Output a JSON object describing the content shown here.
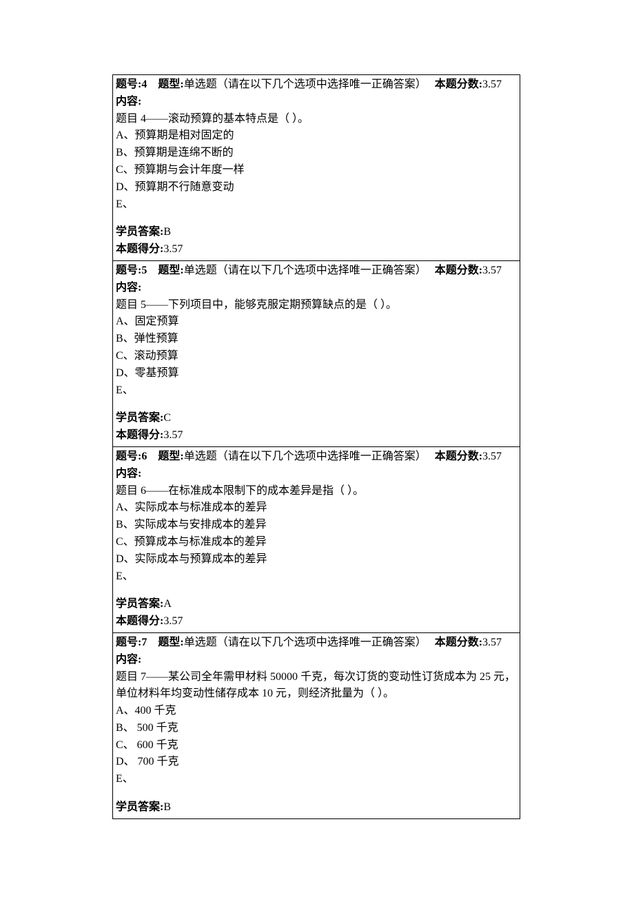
{
  "labels": {
    "qnum_prefix": "题号:",
    "qtype_prefix": "题型:",
    "score_prefix": "本题分数:",
    "content_label": "内容:",
    "student_answer_prefix": "学员答案:",
    "earned_prefix": "本题得分:"
  },
  "questions": [
    {
      "num": "4",
      "type": "单选题（请在以下几个选项中选择唯一正确答案）",
      "score": "3.57",
      "stem": "题目 4——滚动预算的基本特点是（ ）。",
      "opts": {
        "A": "A、预算期是相对固定的",
        "B": "B、预算期是连绵不断的",
        "C": "C、预算期与会计年度一样",
        "D": "D、预算期不行随意变动",
        "E": "E、"
      },
      "answer": "B",
      "earned": "3.57"
    },
    {
      "num": "5",
      "type": "单选题（请在以下几个选项中选择唯一正确答案）",
      "score": "3.57",
      "stem": "题目 5——下列项目中，能够克服定期预算缺点的是（ ）。",
      "opts": {
        "A": "A、固定预算",
        "B": "B、弹性预算",
        "C": "C、滚动预算",
        "D": "D、零基预算",
        "E": "E、"
      },
      "answer": "C",
      "earned": "3.57"
    },
    {
      "num": "6",
      "type": "单选题（请在以下几个选项中选择唯一正确答案）",
      "score": "3.57",
      "stem": "题目 6——在标准成本限制下的成本差异是指（ ）。",
      "opts": {
        "A": "A、实际成本与标准成本的差异",
        "B": "B、实际成本与安排成本的差异",
        "C": "C、预算成本与标准成本的差异",
        "D": "D、实际成本与预算成本的差异",
        "E": "E、"
      },
      "answer": "A",
      "earned": "3.57"
    },
    {
      "num": "7",
      "type": "单选题（请在以下几个选项中选择唯一正确答案）",
      "score": "3.57",
      "stem": "题目 7——某公司全年需甲材料 50000 千克，每次订货的变动性订货成本为 25 元，单位材料年均变动性储存成本 10 元，则经济批量为（ ）。",
      "opts": {
        "A": "A、400 千克",
        "B": "B、 500 千克",
        "C": "C、 600 千克",
        "D": "D、 700 千克",
        "E": "E、"
      },
      "answer": "B",
      "earned": ""
    }
  ]
}
